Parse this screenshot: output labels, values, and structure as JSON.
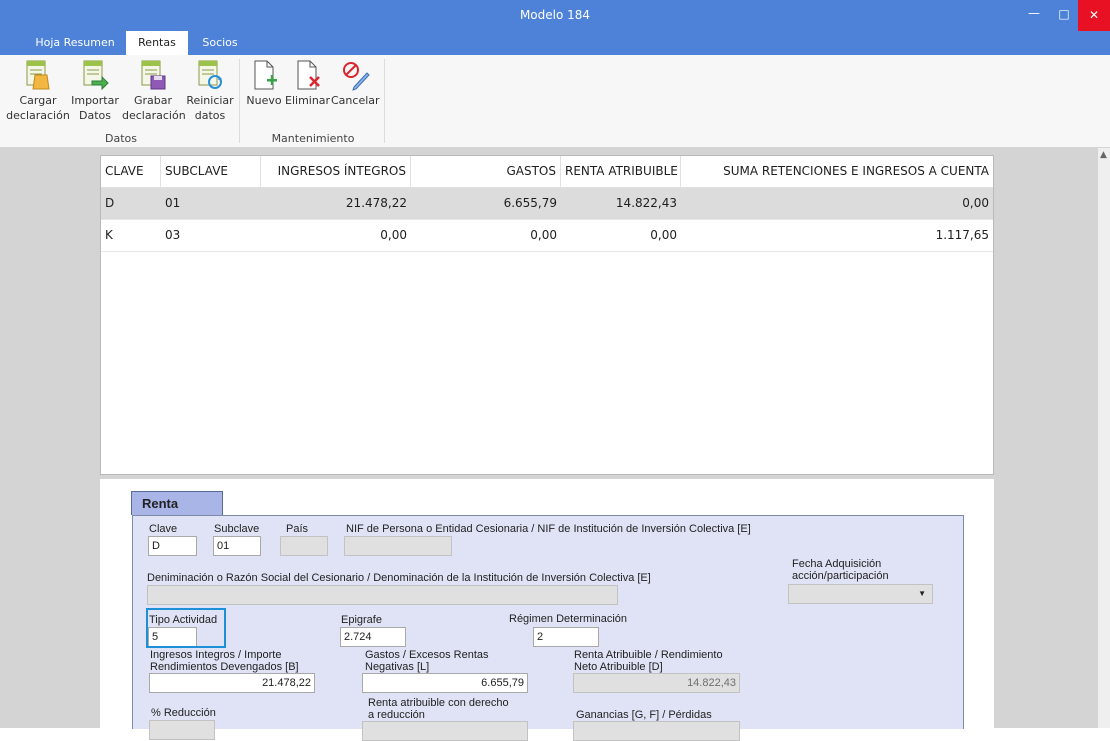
{
  "window": {
    "title": "Modelo 184",
    "minimize": "—",
    "maximize": "□",
    "close": "✕"
  },
  "tabs": [
    {
      "label": "Hoja Resumen"
    },
    {
      "label": "Rentas"
    },
    {
      "label": "Socios"
    }
  ],
  "ribbon": {
    "groups": {
      "datos": "Datos",
      "mantenimiento": "Mantenimiento"
    },
    "buttons": {
      "cargar": {
        "line1": "Cargar",
        "line2": "declaración",
        "icon": "load-declaration-icon"
      },
      "importar": {
        "line1": "Importar",
        "line2": "Datos",
        "icon": "import-data-icon"
      },
      "grabar": {
        "line1": "Grabar",
        "line2": "declaración",
        "icon": "save-declaration-icon"
      },
      "reiniciar": {
        "line1": "Reiniciar",
        "line2": "datos",
        "icon": "reset-data-icon"
      },
      "nuevo": {
        "line1": "Nuevo",
        "icon": "new-document-icon"
      },
      "eliminar": {
        "line1": "Eliminar",
        "icon": "delete-document-icon"
      },
      "cancelar": {
        "line1": "Cancelar",
        "icon": "cancel-edit-icon"
      }
    }
  },
  "grid": {
    "headers": [
      "CLAVE",
      "SUBCLAVE",
      "INGRESOS ÍNTEGROS",
      "GASTOS",
      "RENTA ATRIBUIBLE",
      "SUMA RETENCIONES E INGRESOS A CUENTA"
    ],
    "rows": [
      [
        "D",
        "01",
        "21.478,22",
        "6.655,79",
        "14.822,43",
        "0,00"
      ],
      [
        "K",
        "03",
        "0,00",
        "0,00",
        "0,00",
        "1.117,65"
      ]
    ]
  },
  "form": {
    "tab_label": "Renta",
    "clave": {
      "label": "Clave",
      "value": "D"
    },
    "subclave": {
      "label": "Subclave",
      "value": "01"
    },
    "pais": {
      "label": "País",
      "value": ""
    },
    "nif": {
      "label": "NIF de Persona o Entidad Cesionaria / NIF de Institución de Inversión Colectiva [E]",
      "value": ""
    },
    "fecha_adquisicion": {
      "label1": "Fecha Adquisición",
      "label2": "acción/participación",
      "value": "",
      "arrow": "▼"
    },
    "denominacion": {
      "label": "Deniminación o Razón Social del Cesionario / Denominación de la Institución de Inversión Colectiva [E]",
      "value": ""
    },
    "tipo_actividad": {
      "label": "Tipo Actividad",
      "value": "5"
    },
    "epigrafe": {
      "label": "Epigrafe",
      "value": "2.724"
    },
    "regimen": {
      "label": "Régimen Determinación",
      "value": "2"
    },
    "ingresos": {
      "label1": "Ingresos Integros / Importe",
      "label2": "Rendimientos Devengados [B]",
      "value": "21.478,22"
    },
    "gastos": {
      "label1": "Gastos / Excesos Rentas",
      "label2": "Negativas [L]",
      "value": "6.655,79"
    },
    "renta_atribuible": {
      "label1": "Renta Atribuible / Rendimiento",
      "label2": "Neto Atribuible [D]",
      "value": "14.822,43"
    },
    "reduccion": {
      "label": "% Reducción"
    },
    "renta_reduccion": {
      "label1": "Renta atribuible con derecho",
      "label2": "a reducción"
    },
    "ganancias": {
      "label": "Ganancias [G, F] / Pérdidas"
    }
  }
}
